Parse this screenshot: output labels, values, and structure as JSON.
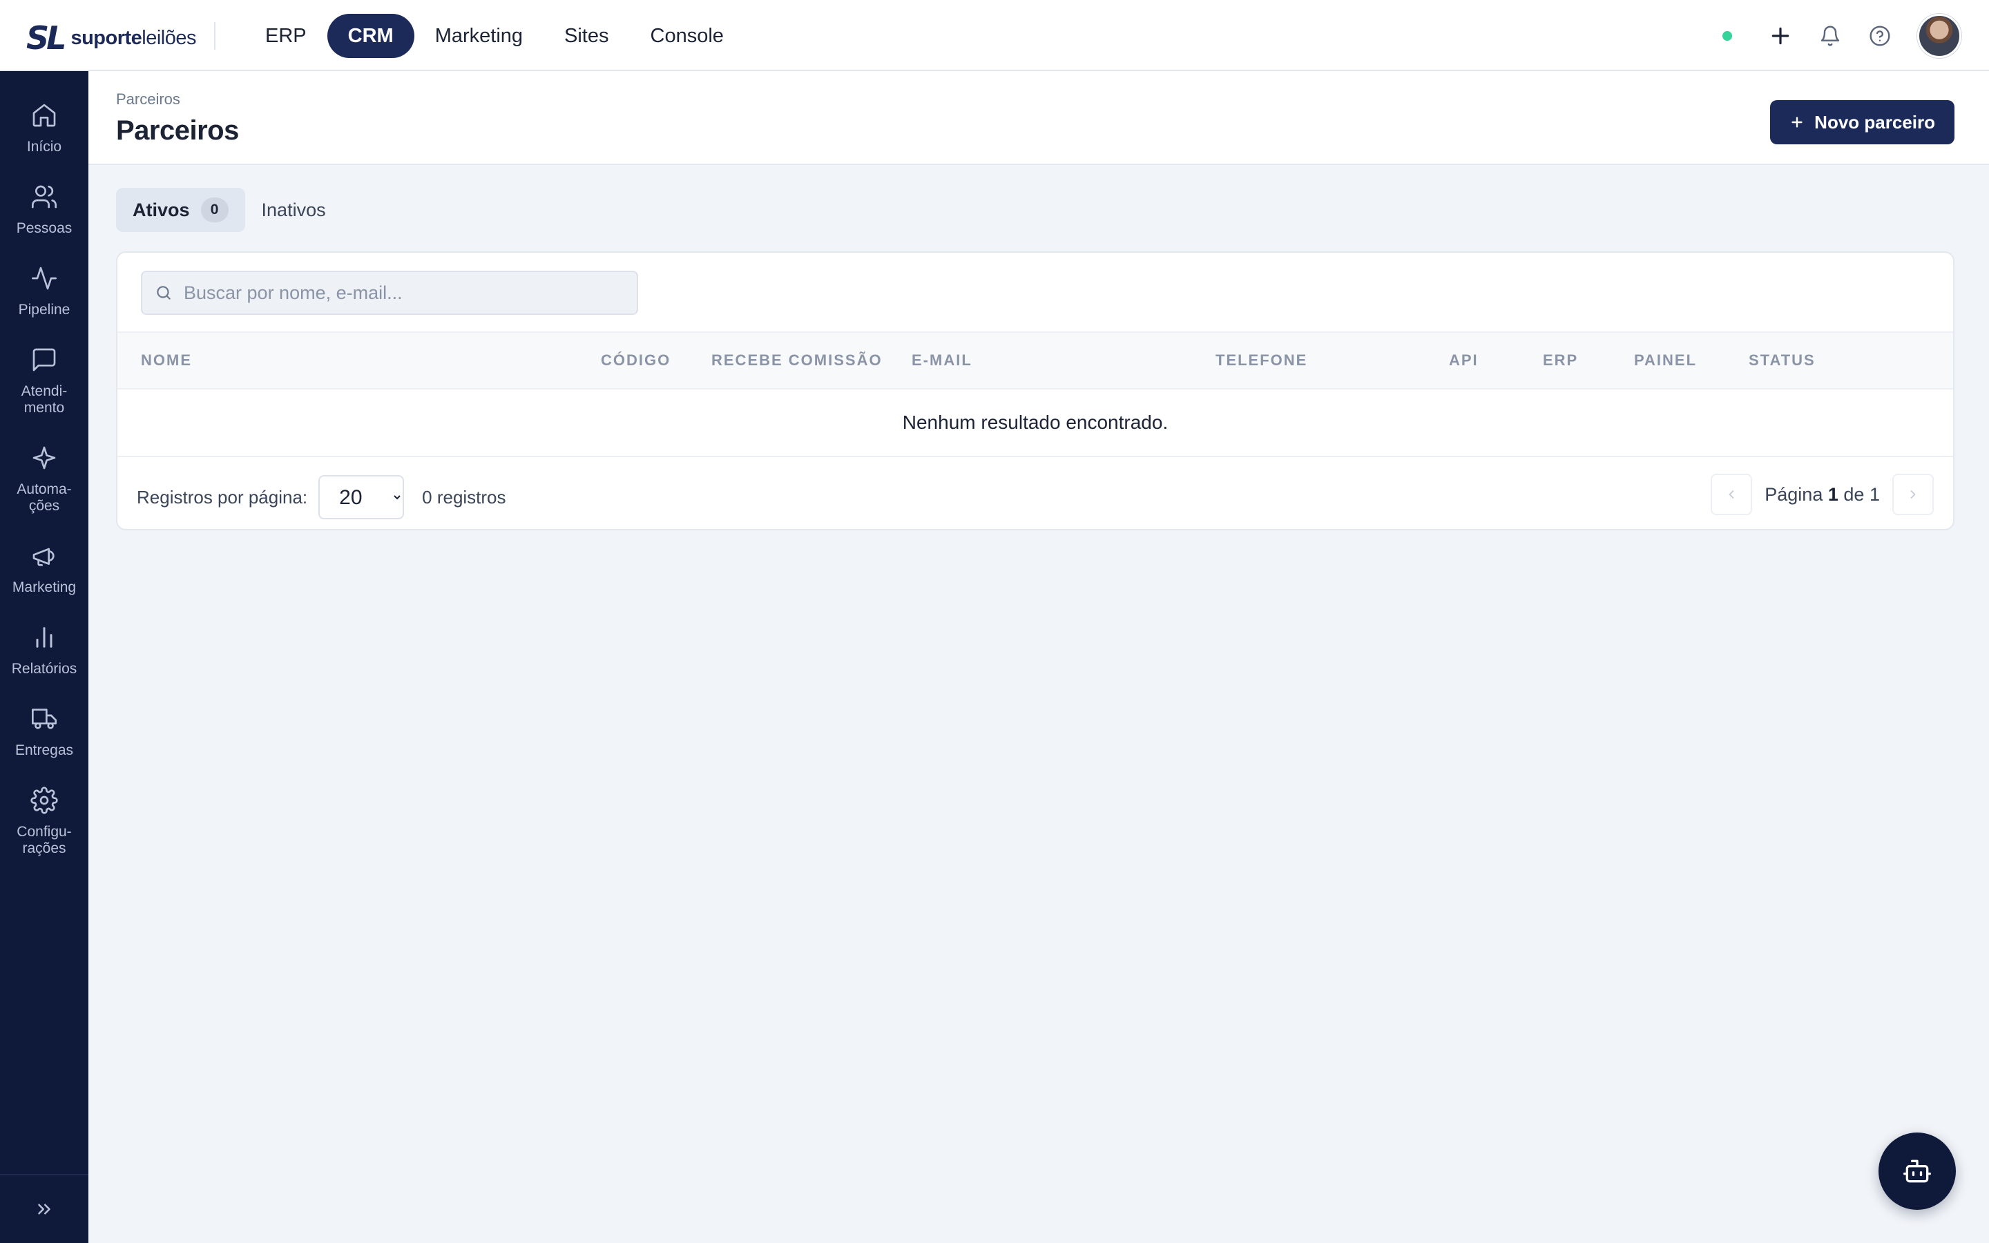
{
  "brand": {
    "mark": "SL",
    "name_bold": "suporte",
    "name_light": "leilões"
  },
  "topnav": {
    "items": [
      {
        "label": "ERP"
      },
      {
        "label": "CRM"
      },
      {
        "label": "Marketing"
      },
      {
        "label": "Sites"
      },
      {
        "label": "Console"
      }
    ],
    "active": "CRM"
  },
  "top_actions": {
    "status_color": "#34d399",
    "icons": [
      "plus-icon",
      "bell-icon",
      "help-icon"
    ]
  },
  "sidebar": {
    "items": [
      {
        "label": "Início",
        "icon": "home-icon"
      },
      {
        "label": "Pessoas",
        "icon": "users-icon"
      },
      {
        "label": "Pipeline",
        "icon": "activity-icon"
      },
      {
        "label": "Atendi-\nmento",
        "icon": "message-icon"
      },
      {
        "label": "Automa-\nções",
        "icon": "sparkle-icon"
      },
      {
        "label": "Marketing",
        "icon": "megaphone-icon"
      },
      {
        "label": "Relatórios",
        "icon": "bar-chart-icon"
      },
      {
        "label": "Entregas",
        "icon": "truck-icon"
      },
      {
        "label": "Configu-\nrações",
        "icon": "gear-icon"
      }
    ],
    "toggle_icon": "chevrons-right-icon"
  },
  "header": {
    "breadcrumb": "Parceiros",
    "title": "Parceiros",
    "new_button_label": "Novo parceiro"
  },
  "tabs": [
    {
      "label": "Ativos",
      "count": "0",
      "active": true
    },
    {
      "label": "Inativos"
    }
  ],
  "search": {
    "placeholder": "Buscar por nome, e-mail...",
    "value": ""
  },
  "table": {
    "columns": [
      "Nome",
      "Código",
      "Recebe comissão",
      "E-mail",
      "Telefone",
      "API",
      "ERP",
      "Painel",
      "Status"
    ],
    "empty_message": "Nenhum resultado encontrado."
  },
  "footer": {
    "per_page_label": "Registros por página:",
    "per_page_value": "20",
    "records_label": "0 registros",
    "page_prefix": "Página",
    "page_current": "1",
    "page_of": "de",
    "page_total": "1"
  },
  "colors": {
    "brand_navy": "#1c2a5a",
    "sidebar_bg": "#0f1a3b"
  }
}
